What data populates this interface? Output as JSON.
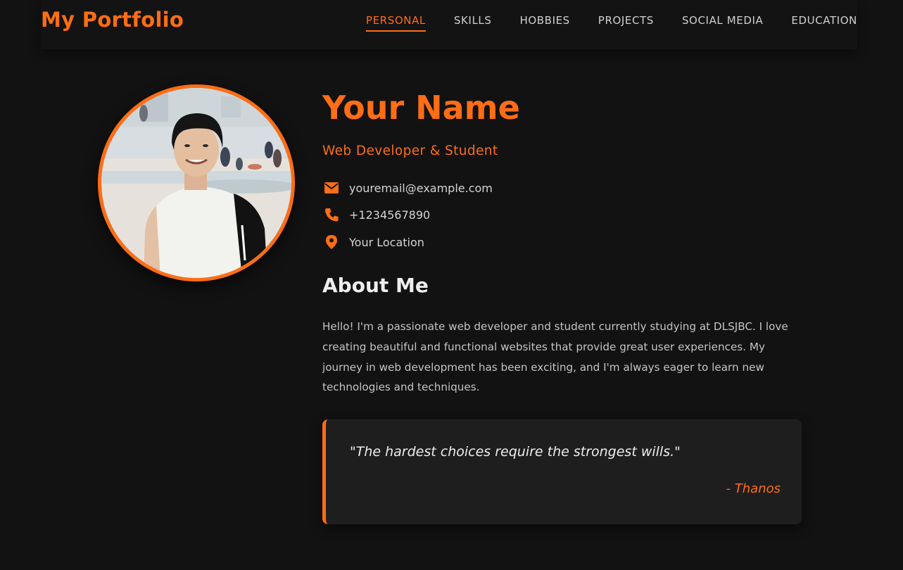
{
  "header": {
    "brand": "My Portfolio",
    "nav": [
      {
        "label": "PERSONAL",
        "active": true
      },
      {
        "label": "SKILLS",
        "active": false
      },
      {
        "label": "HOBBIES",
        "active": false
      },
      {
        "label": "PROJECTS",
        "active": false
      },
      {
        "label": "SOCIAL MEDIA",
        "active": false
      },
      {
        "label": "EDUCATION",
        "active": false
      }
    ]
  },
  "profile": {
    "name": "Your Name",
    "title": "Web Developer & Student",
    "contacts": [
      {
        "icon": "envelope-icon",
        "value": "youremail@example.com"
      },
      {
        "icon": "phone-icon",
        "value": "+1234567890"
      },
      {
        "icon": "location-pin-icon",
        "value": "Your Location"
      }
    ]
  },
  "about": {
    "heading": "About Me",
    "text": "Hello! I'm a passionate web developer and student currently studying at DLSJBC. I love creating beautiful and functional websites that provide great user experiences. My journey in web development has been exciting, and I'm always eager to learn new technologies and techniques."
  },
  "quote": {
    "text": "\"The hardest choices require the strongest wills.\"",
    "author": "- Thanos"
  },
  "colors": {
    "accent": "#ff6d14",
    "background": "#121212",
    "card": "#1e1e1e"
  }
}
